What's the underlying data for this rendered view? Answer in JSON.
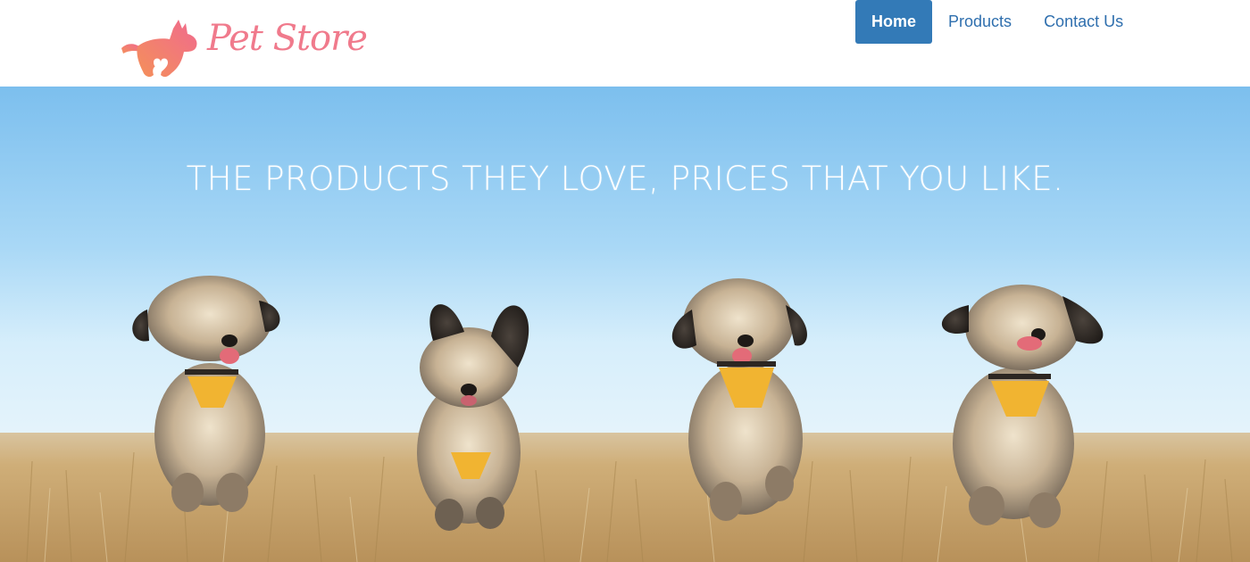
{
  "brand": {
    "name": "Pet Store",
    "accent_color": "#f07a8c",
    "logo_icon": "dog-heart-logo-icon"
  },
  "nav": {
    "items": [
      {
        "label": "Home",
        "active": true
      },
      {
        "label": "Products",
        "active": false
      },
      {
        "label": "Contact Us",
        "active": false
      }
    ],
    "active_color": "#337ab7",
    "link_color": "#2f6fae"
  },
  "hero": {
    "tagline": "THE PRODUCTS THEY LOVE, PRICES THAT YOU LIKE.",
    "image_subject": "four-running-dogs-photo",
    "sky_color": "#8fcaf0",
    "field_color": "#c9a46a"
  }
}
